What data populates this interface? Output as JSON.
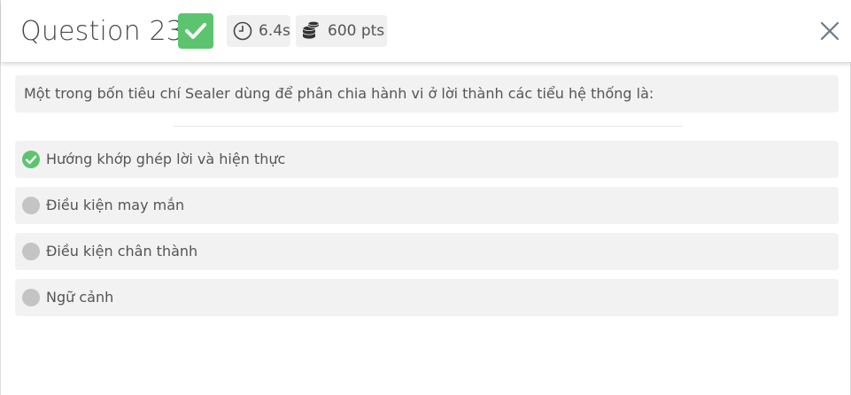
{
  "header": {
    "question_title": "Question 23",
    "status": "correct",
    "time_label": "6.4s",
    "points_label": "600 pts",
    "close_icon": "close-icon"
  },
  "question": {
    "text": "Một trong bốn tiêu chí Sealer dùng để phân chia hành vi ở lời thành các tiểu hệ thống là:"
  },
  "options": [
    {
      "label": "Hướng khớp ghép lời và hiện thực",
      "state": "correct"
    },
    {
      "label": "Điều kiện may mắn",
      "state": "unselected"
    },
    {
      "label": "Điều kiện chân thành",
      "state": "unselected"
    },
    {
      "label": "Ngữ cảnh",
      "state": "unselected"
    }
  ],
  "colors": {
    "correct_green": "#5cc46f",
    "pill_bg": "#f0f0f0",
    "option_bg": "#f2f2f2",
    "dot_gray": "#c4c4c4"
  }
}
